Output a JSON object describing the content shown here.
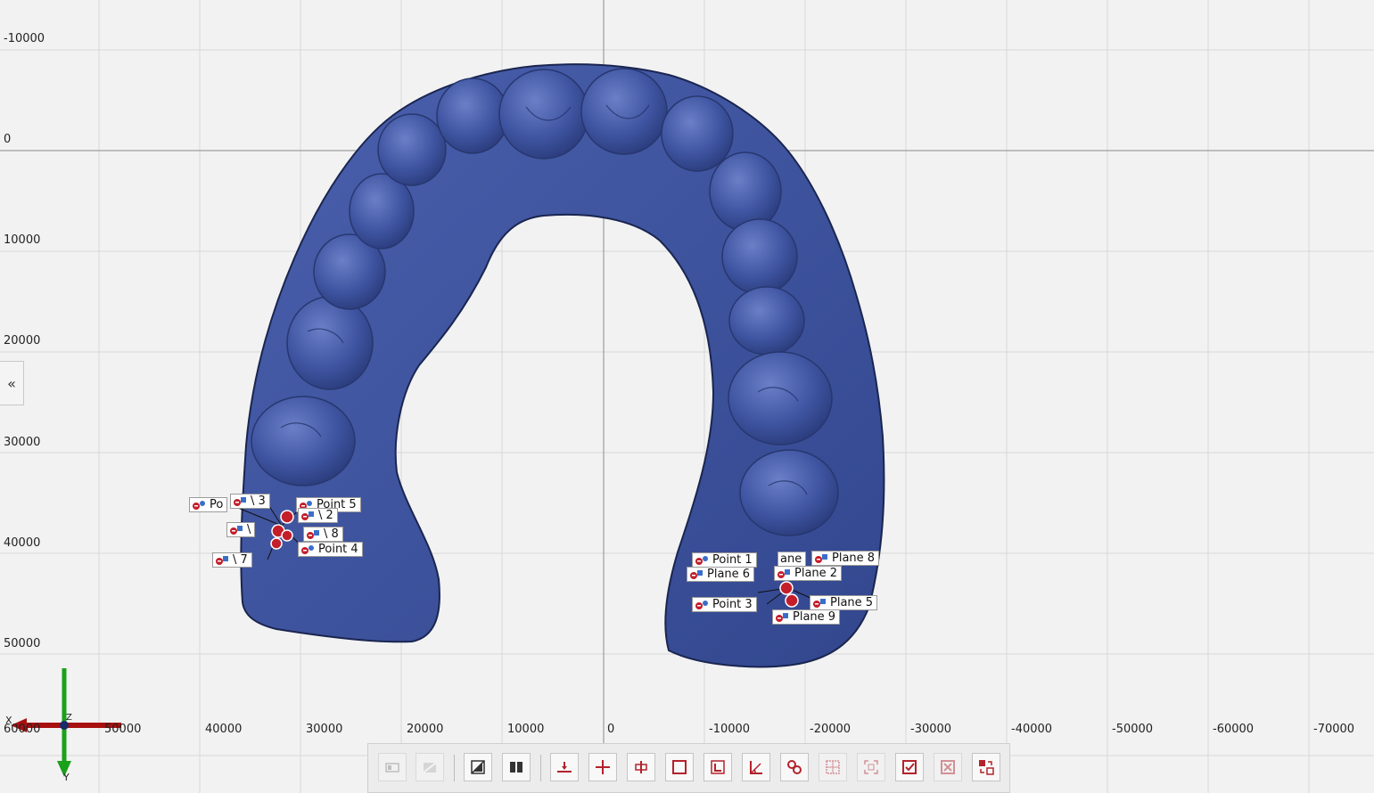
{
  "axes": {
    "y_ticks": [
      "-10000",
      "0",
      "10000",
      "20000",
      "30000",
      "40000",
      "50000"
    ],
    "x_ticks": [
      "60000",
      "50000",
      "40000",
      "30000",
      "20000",
      "10000",
      "0",
      "-10000",
      "-20000",
      "-30000",
      "-40000",
      "-50000",
      "-60000",
      "-70000"
    ],
    "gizmo": {
      "x_label": "X",
      "y_label": "Y",
      "z_label": "Z"
    }
  },
  "panel": {
    "collapse_label": "«"
  },
  "markers": {
    "left_cluster": [
      {
        "label": "Po",
        "type": "point"
      },
      {
        "label": "\\ 3",
        "type": "plane"
      },
      {
        "label": "Point 5",
        "type": "point"
      },
      {
        "label": "\\ 2",
        "type": "plane"
      },
      {
        "label": "\\",
        "type": "plane"
      },
      {
        "label": "\\ 8",
        "type": "plane"
      },
      {
        "label": "Point 4",
        "type": "point"
      },
      {
        "label": "\\ 7",
        "type": "plane"
      }
    ],
    "right_cluster": [
      {
        "label": "Point 1",
        "type": "point"
      },
      {
        "label": "ane",
        "type": "plane"
      },
      {
        "label": "Plane 8",
        "type": "plane"
      },
      {
        "label": "Plane 6",
        "type": "plane"
      },
      {
        "label": "Plane 2",
        "type": "plane"
      },
      {
        "label": "Point 3",
        "type": "point"
      },
      {
        "label": "Plane 5",
        "type": "plane"
      },
      {
        "label": "Plane 9",
        "type": "plane"
      }
    ]
  },
  "colors": {
    "model": "#3a4f9a",
    "grid": "#d6d6d6",
    "axis_major": "#7a7a7a",
    "tool_red": "#b3222c",
    "gizmo_x": "#a81010",
    "gizmo_y": "#1aa01a"
  },
  "toolbar": {
    "tools": [
      {
        "icon": "view-box-icon",
        "enabled": false
      },
      {
        "icon": "slash-box-icon",
        "enabled": false
      },
      {
        "icon": "transparency-icon",
        "enabled": true
      },
      {
        "icon": "split-view-icon",
        "enabled": true
      },
      {
        "icon": "point-on-plane-icon",
        "enabled": true
      },
      {
        "icon": "point-cross-icon",
        "enabled": true
      },
      {
        "icon": "plane-section-icon",
        "enabled": true
      },
      {
        "icon": "rectangle-icon",
        "enabled": true
      },
      {
        "icon": "corner-select-icon",
        "enabled": true
      },
      {
        "icon": "angle-measure-icon",
        "enabled": true
      },
      {
        "icon": "link-circles-icon",
        "enabled": true
      },
      {
        "icon": "grid-box-icon",
        "enabled": false
      },
      {
        "icon": "fit-frame-icon",
        "enabled": false
      },
      {
        "icon": "check-box-icon",
        "enabled": true
      },
      {
        "icon": "cross-box-icon",
        "enabled": false
      },
      {
        "icon": "swap-blocks-icon",
        "enabled": true
      }
    ]
  }
}
